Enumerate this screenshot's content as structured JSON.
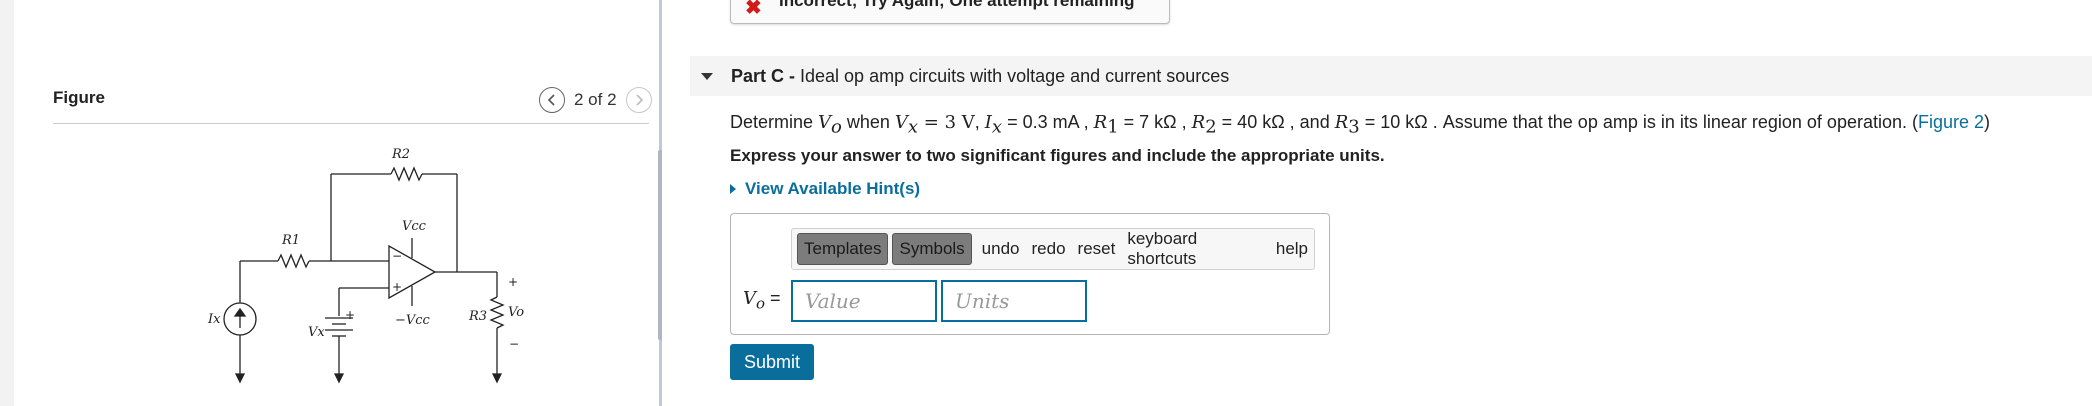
{
  "figure": {
    "title": "Figure",
    "counter": "2 of 2",
    "labels": {
      "r2": "R2",
      "r1": "R1",
      "r3": "R3",
      "vcc": "Vcc",
      "neg_vcc": "−Vcc",
      "ix": "Ix",
      "vx": "Vx",
      "vo": "Vo",
      "plus": "+",
      "minus": "−"
    }
  },
  "feedback": {
    "text": "Incorrect; Try Again; One attempt remaining"
  },
  "part": {
    "label": "Part C -",
    "description": "Ideal op amp circuits with voltage and current sources"
  },
  "question": {
    "t1": "Determine ",
    "vo": "V",
    "vo_sub": "o",
    "t2": " when ",
    "vx": "V",
    "vx_sub": "x",
    "vx_val": " = 3 V",
    "t3": ", ",
    "ix": "I",
    "ix_sub": "x",
    "ix_val": " = 0.3 mA",
    "t4": " , ",
    "r1": "R",
    "r1_sub": "1",
    "r1_val": " = 7 kΩ",
    "t5": " , ",
    "r2": "R",
    "r2_sub": "2",
    "r2_val": " = 40 kΩ",
    "t6": " , and ",
    "r3": "R",
    "r3_sub": "3",
    "r3_val": " = 10 kΩ",
    "t7": " . Assume that the op amp is in its linear region of operation. (",
    "link": "Figure 2",
    "t8": ")"
  },
  "instructions": "Express your answer to two significant figures and include the appropriate units.",
  "hints": "View Available Hint(s)",
  "toolbar": {
    "templates": "Templates",
    "symbols": "Symbols",
    "undo": "undo",
    "redo": "redo",
    "reset": "reset",
    "shortcuts": "keyboard shortcuts",
    "help": "help"
  },
  "answer": {
    "label_var": "V",
    "label_sub": "o",
    "label_eq": " =",
    "value_placeholder": "Value",
    "units_placeholder": "Units"
  },
  "submit": "Submit",
  "colors": {
    "accent": "#0a6e9c",
    "error": "#d21a1a"
  }
}
